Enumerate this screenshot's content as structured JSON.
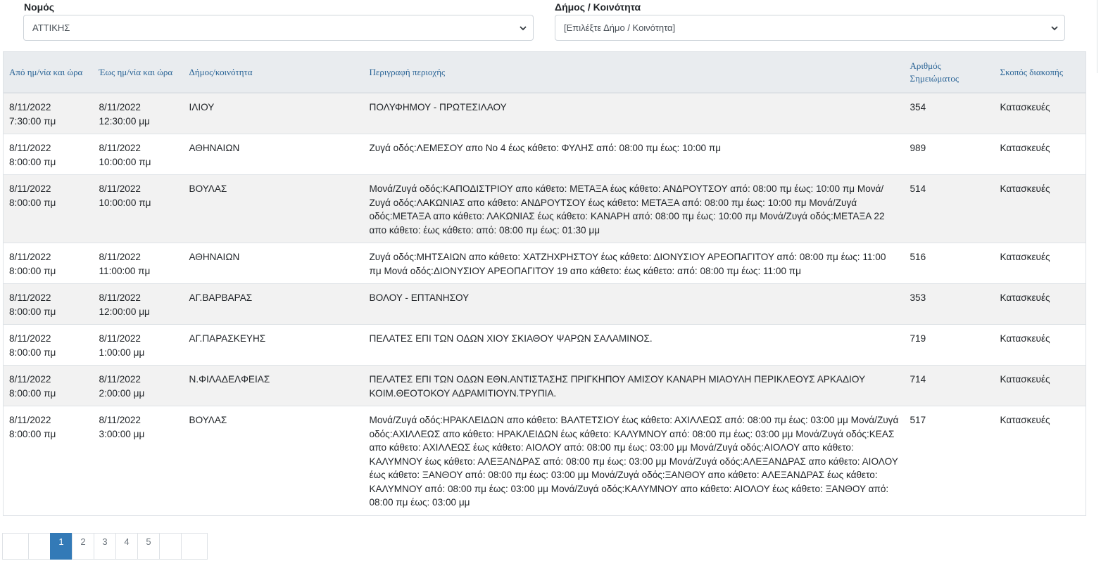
{
  "filters": {
    "nomos": {
      "label": "Νομός",
      "value": "ΑΤΤΙΚΗΣ"
    },
    "dimos": {
      "label": "Δήμος / Κοινότητα",
      "value": "[Επιλέξτε Δήμο / Κοινότητα]"
    }
  },
  "table": {
    "headers": {
      "from": "Από ημ/νία και ώρα",
      "to": "Έως ημ/νία και ώρα",
      "municipality": "Δήμος/κοινότητα",
      "area": "Περιγραφή περιοχής",
      "number_line1": "Αριθμός",
      "number_line2": "Σημειώματος",
      "purpose": "Σκοπός διακοπής"
    },
    "rows": [
      {
        "from_date": "8/11/2022",
        "from_time": "7:30:00 πμ",
        "to_date": "8/11/2022",
        "to_time": "12:30:00 μμ",
        "municipality": "ΙΛΙΟΥ",
        "area": "ΠΟΛΥΦΗΜΟΥ - ΠΡΩΤΕΣΙΛΑΟΥ",
        "number": "354",
        "purpose": "Κατασκευές"
      },
      {
        "from_date": "8/11/2022",
        "from_time": "8:00:00 πμ",
        "to_date": "8/11/2022",
        "to_time": "10:00:00 πμ",
        "municipality": "ΑΘΗΝΑΙΩΝ",
        "area": "Ζυγά οδός:ΛΕΜΕΣΟΥ απο Νο 4 έως κάθετο: ΦΥΛΗΣ από: 08:00 πμ έως: 10:00 πμ",
        "number": "989",
        "purpose": "Κατασκευές"
      },
      {
        "from_date": "8/11/2022",
        "from_time": "8:00:00 πμ",
        "to_date": "8/11/2022",
        "to_time": "10:00:00 πμ",
        "municipality": "ΒΟΥΛΑΣ",
        "area": "Μονά/Ζυγά οδός:ΚΑΠΟΔΙΣΤΡΙΟΥ απο κάθετο: ΜΕΤΑΞΑ έως κάθετο: ΑΝΔΡΟΥΤΣΟΥ από: 08:00 πμ έως: 10:00 πμ Μονά/Ζυγά οδός:ΛΑΚΩΝΙΑΣ απο κάθετο: ΑΝΔΡΟΥΤΣΟΥ έως κάθετο: ΜΕΤΑΞΑ από: 08:00 πμ έως: 10:00 πμ Μονά/Ζυγά οδός:ΜΕΤΑΞΑ απο κάθετο: ΛΑΚΩΝΙΑΣ έως κάθετο: ΚΑΝΑΡΗ από: 08:00 πμ έως: 10:00 πμ Μονά/Ζυγά οδός:ΜΕΤΑΞΑ 22 απο κάθετο: έως κάθετο: από: 08:00 πμ έως: 01:30 μμ",
        "number": "514",
        "purpose": "Κατασκευές"
      },
      {
        "from_date": "8/11/2022",
        "from_time": "8:00:00 πμ",
        "to_date": "8/11/2022",
        "to_time": "11:00:00 πμ",
        "municipality": "ΑΘΗΝΑΙΩΝ",
        "area": "Ζυγά οδός:ΜΗΤΣΑΙΩΝ απο κάθετο: ΧΑΤΖΗΧΡΗΣΤΟΥ έως κάθετο: ΔΙΟΝΥΣΙΟΥ ΑΡΕΟΠΑΓΙΤΟΥ από: 08:00 πμ έως: 11:00 πμ Μονά οδός:ΔΙΟΝΥΣΙΟΥ ΑΡΕΟΠΑΓΙΤΟΥ 19 απο κάθετο: έως κάθετο: από: 08:00 πμ έως: 11:00 πμ",
        "number": "516",
        "purpose": "Κατασκευές"
      },
      {
        "from_date": "8/11/2022",
        "from_time": "8:00:00 πμ",
        "to_date": "8/11/2022",
        "to_time": "12:00:00 μμ",
        "municipality": "ΑΓ.ΒΑΡΒΑΡΑΣ",
        "area": "ΒΟΛΟΥ - ΕΠΤΑΝΗΣΟΥ",
        "number": "353",
        "purpose": "Κατασκευές"
      },
      {
        "from_date": "8/11/2022",
        "from_time": "8:00:00 πμ",
        "to_date": "8/11/2022",
        "to_time": "1:00:00 μμ",
        "municipality": "ΑΓ.ΠΑΡΑΣΚΕΥΗΣ",
        "area": "ΠΕΛΑΤΕΣ ΕΠΙ ΤΩΝ ΟΔΩΝ ΧΙΟΥ ΣΚΙΑΘΟΥ ΨΑΡΩΝ ΣΑΛΑΜΙΝΟΣ.",
        "number": "719",
        "purpose": "Κατασκευές"
      },
      {
        "from_date": "8/11/2022",
        "from_time": "8:00:00 πμ",
        "to_date": "8/11/2022",
        "to_time": "2:00:00 μμ",
        "municipality": "Ν.ΦΙΛΑΔΕΛΦΕΙΑΣ",
        "area": "ΠΕΛΑΤΕΣ ΕΠΙ ΤΩΝ ΟΔΩΝ ΕΘΝ.ΑΝΤΙΣΤΑΣΗΣ ΠΡΙΓΚΗΠΟΥ ΑΜΙΣΟΥ ΚΑΝΑΡΗ ΜΙΑΟΥΛΗ ΠΕΡΙΚΛΕΟΥΣ ΑΡΚΑΔΙΟΥ ΚΟΙΜ.ΘΕΟΤΟΚΟΥ ΑΔΡΑΜΙΤΙΟΥΝ.ΤΡΥΠΙΑ.",
        "number": "714",
        "purpose": "Κατασκευές"
      },
      {
        "from_date": "8/11/2022",
        "from_time": "8:00:00 πμ",
        "to_date": "8/11/2022",
        "to_time": "3:00:00 μμ",
        "municipality": "ΒΟΥΛΑΣ",
        "area": "Μονά/Ζυγά οδός:ΗΡΑΚΛΕΙΔΩΝ απο κάθετο: ΒΑΛΤΕΤΣΙΟΥ έως κάθετο: ΑΧΙΛΛΕΩΣ από: 08:00 πμ έως: 03:00 μμ Μονά/Ζυγά οδός:ΑΧΙΛΛΕΩΣ απο κάθετο: ΗΡΑΚΛΕΙΔΩΝ έως κάθετο: ΚΑΛΥΜΝΟΥ από: 08:00 πμ έως: 03:00 μμ Μονά/Ζυγά οδός:ΚΕΑΣ απο κάθετο: ΑΧΙΛΛΕΩΣ έως κάθετο: ΑΙΟΛΟΥ από: 08:00 πμ έως: 03:00 μμ Μονά/Ζυγά οδός:ΑΙΟΛΟΥ απο κάθετο: ΚΑΛΥΜΝΟΥ έως κάθετο: ΑΛΕΞΑΝΔΡΑΣ από: 08:00 πμ έως: 03:00 μμ Μονά/Ζυγά οδός:ΑΛΕΞΑΝΔΡΑΣ απο κάθετο: ΑΙΟΛΟΥ έως κάθετο: ΞΑΝΘΟΥ από: 08:00 πμ έως: 03:00 μμ Μονά/Ζυγά οδός:ΞΑΝΘΟΥ απο κάθετο: ΑΛΕΞΑΝΔΡΑΣ έως κάθετο: ΚΑΛΥΜΝΟΥ από: 08:00 πμ έως: 03:00 μμ Μονά/Ζυγά οδός:ΚΑΛΥΜΝΟΥ απο κάθετο: ΑΙΟΛΟΥ έως κάθετο: ΞΑΝΘΟΥ από: 08:00 πμ έως: 03:00 μμ",
        "number": "517",
        "purpose": "Κατασκευές"
      }
    ]
  },
  "pagination": {
    "pages": [
      "",
      "",
      "1",
      "2",
      "3",
      "4",
      "5",
      "",
      ""
    ],
    "active": "1"
  }
}
